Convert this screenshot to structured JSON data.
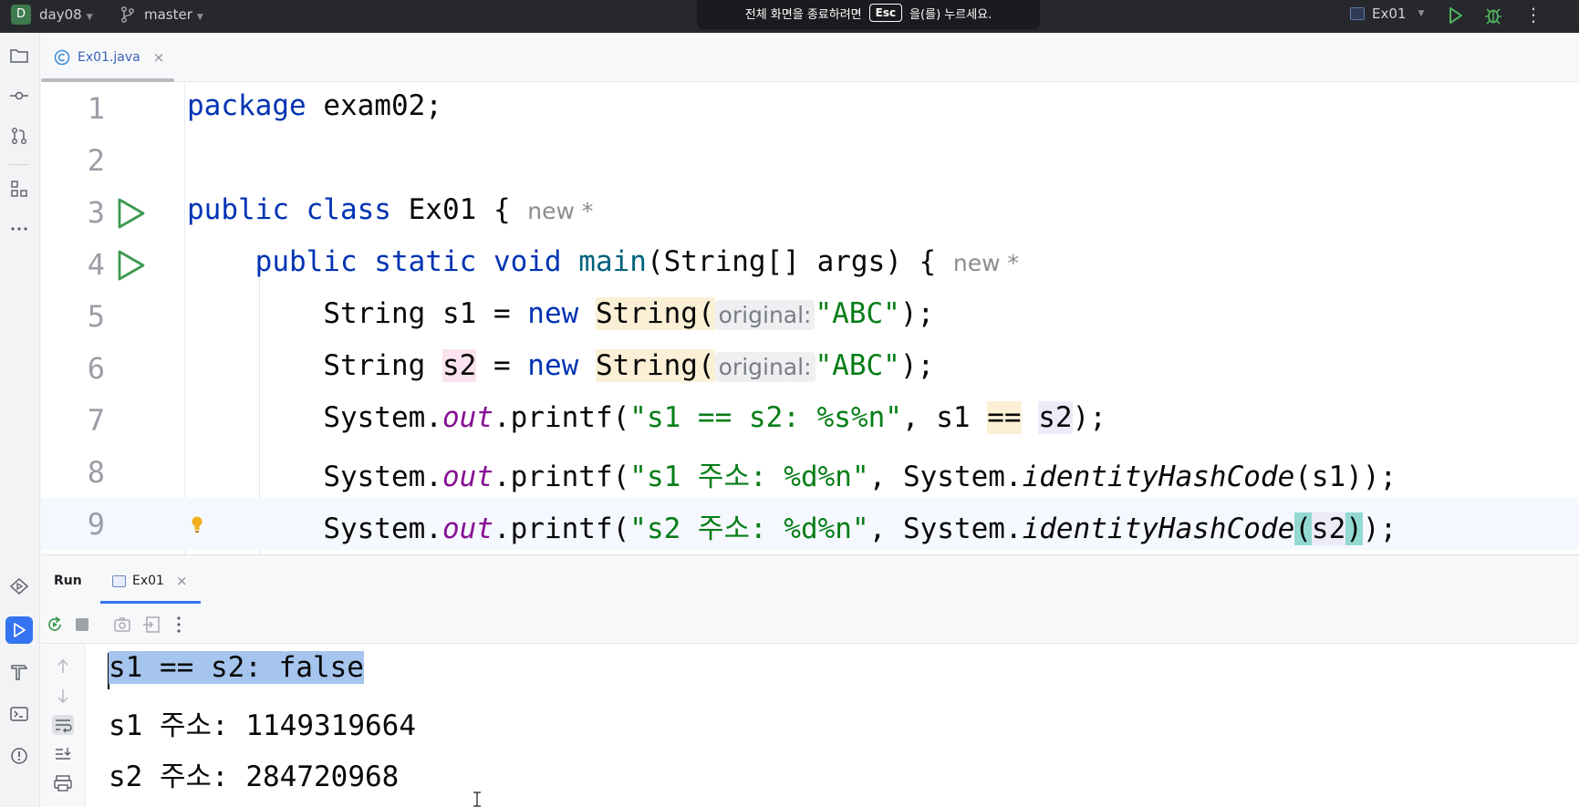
{
  "titlebar": {
    "project_badge": "D",
    "project_name": "day08",
    "branch": "master",
    "toast_pre": "전체 화면을 종료하려면",
    "toast_key": "Esc",
    "toast_post": "을(를) 누르세요.",
    "run_config": "Ex01"
  },
  "editor": {
    "tab_label": "Ex01.java",
    "tab_close": "×",
    "hint_new": "new *",
    "param_hint": "original:"
  },
  "code_lines": [
    {
      "num": "1"
    },
    {
      "num": "2"
    },
    {
      "num": "3"
    },
    {
      "num": "4"
    },
    {
      "num": "5"
    },
    {
      "num": "6"
    },
    {
      "num": "7"
    },
    {
      "num": "8"
    },
    {
      "num": "9"
    }
  ],
  "code": {
    "l1_kw": "package",
    "l1_rest": " exam02;",
    "l3_kw": "public class",
    "l3_rest": " Ex01 { ",
    "l4_kw": "public static void",
    "l4_fn": "main",
    "l4_rest": "(String[] args) { ",
    "l5_a": "String s1 = ",
    "l5_kw": "new",
    "l5_cls": "String",
    "l5_str": "\"ABC\"",
    "l5_end": ");",
    "l6_a": "String ",
    "l6_var": "s2",
    "l6_b": " = ",
    "l6_kw": "new",
    "l6_cls": "String",
    "l6_str": "\"ABC\"",
    "l6_end": ");",
    "l7_a": "System.",
    "l7_fld": "out",
    "l7_b": ".printf(",
    "l7_str": "\"s1 == s2: %s%n\"",
    "l7_c": ", s1 ",
    "l7_op": "==",
    "l7_sp": " ",
    "l7_var": "s2",
    "l7_end": ");",
    "l8_a": "System.",
    "l8_fld": "out",
    "l8_b": ".printf(",
    "l8_str": "\"s1 주소: %d%n\"",
    "l8_c": ", System.",
    "l8_m": "identityHashCode",
    "l8_end": "(s1));",
    "l9_a": "System.",
    "l9_fld": "out",
    "l9_b": ".printf(",
    "l9_str": "\"s2 주소: %d%n\"",
    "l9_c": ", System.",
    "l9_m": "identityHashCode",
    "l9_p1": "(",
    "l9_arg": "s2",
    "l9_p2": ")",
    "l9_end": ");"
  },
  "run_panel": {
    "title": "Run",
    "tab_label": "Ex01",
    "tab_close": "×"
  },
  "console": {
    "lines": [
      "s1 == s2: false",
      "s1 주소: 1149319664",
      "s2 주소: 284720968"
    ]
  },
  "colors": {
    "keyword": "#0033b3",
    "string": "#067d17",
    "field": "#871094",
    "accent": "#3574f0",
    "run_green": "#3d9a50",
    "selection": "#a6c5ee"
  },
  "icons": [
    "folder-icon",
    "commit-icon",
    "pull-request-icon",
    "structure-icon",
    "more-icon",
    "services-icon",
    "run-icon",
    "build-icon",
    "terminal-icon",
    "problems-icon",
    "branch-icon",
    "debug-icon"
  ]
}
